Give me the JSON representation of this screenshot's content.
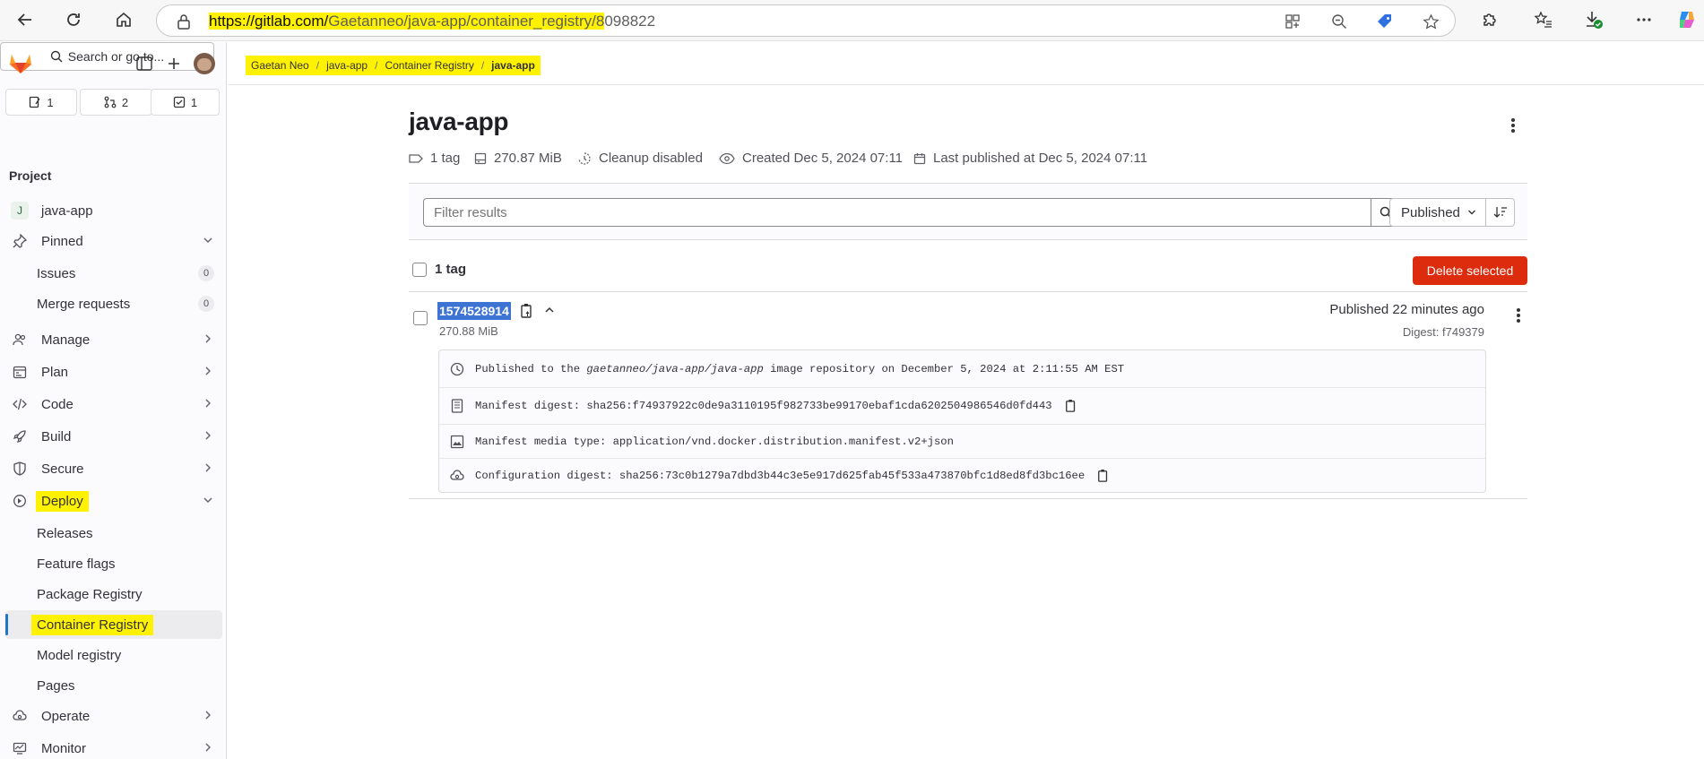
{
  "browser": {
    "url_prefix": "https://gitlab.com/",
    "url_path": "Gaetanneo/java-app/container_registry/8",
    "url_tail": "098822"
  },
  "sidebar": {
    "counters": {
      "issues": "1",
      "merge_requests": "2",
      "todos": "1"
    },
    "search_label": "Search or go to...",
    "section_title": "Project",
    "project_avatar": "J",
    "project_name": "java-app",
    "pinned_label": "Pinned",
    "pinned_items": [
      {
        "label": "Issues",
        "count": "0"
      },
      {
        "label": "Merge requests",
        "count": "0"
      }
    ],
    "items": {
      "manage": "Manage",
      "plan": "Plan",
      "code": "Code",
      "build": "Build",
      "secure": "Secure",
      "deploy": "Deploy",
      "operate": "Operate",
      "monitor": "Monitor"
    },
    "deploy_items": {
      "releases": "Releases",
      "feature_flags": "Feature flags",
      "package_registry": "Package Registry",
      "container_registry": "Container Registry",
      "model_registry": "Model registry",
      "pages": "Pages"
    }
  },
  "breadcrumb": [
    "Gaetan Neo",
    "java-app",
    "Container Registry",
    "java-app"
  ],
  "repo": {
    "title": "java-app",
    "tags": "1 tag",
    "size": "270.87 MiB",
    "cleanup": "Cleanup disabled",
    "created": "Created Dec 5, 2024 07:11",
    "last_published": "Last published at Dec 5, 2024 07:11"
  },
  "filter": {
    "placeholder": "Filter results",
    "sort_label": "Published"
  },
  "list": {
    "select_label": "1 tag",
    "delete_label": "Delete selected"
  },
  "tag": {
    "name": "1574528914",
    "size": "270.88 MiB",
    "published": "Published 22 minutes ago",
    "digest": "Digest: f749379",
    "details": {
      "published_pre": "Published to the ",
      "published_repo": "gaetanneo/java-app/java-app",
      "published_post": " image repository on December 5, 2024 at 2:11:55 AM EST",
      "manifest_digest": "Manifest digest: sha256:f74937922c0de9a3110195f982733be99170ebaf1cda6202504986546d0fd443",
      "media_type": "Manifest media type: application/vnd.docker.distribution.manifest.v2+json",
      "config_digest": "Configuration digest: sha256:73c0b1279a7dbd3b44c3e5e917d625fab45f533a473870bfc1d8ed8fd3bc16ee"
    }
  },
  "colors": {
    "highlight": "#fff200",
    "danger": "#dd2b0e",
    "selection": "#3d73d3",
    "active_bar": "#1f75cb"
  }
}
